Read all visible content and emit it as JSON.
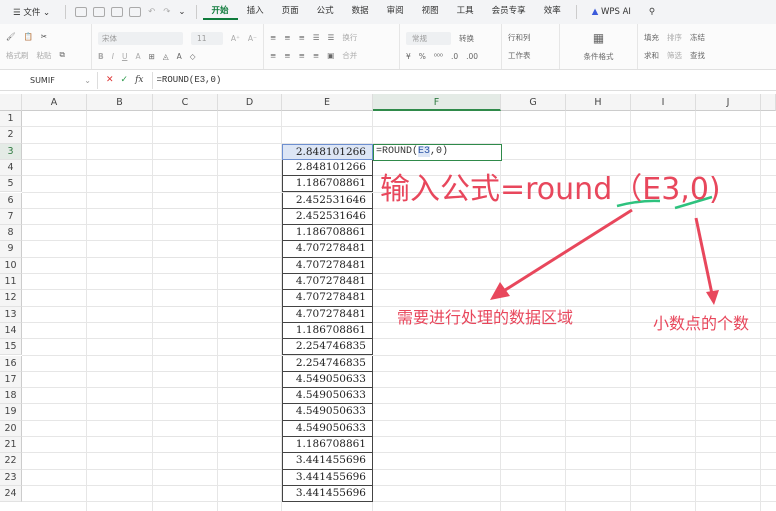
{
  "menubar": {
    "file": "文件",
    "tabs": [
      "开始",
      "插入",
      "页面",
      "公式",
      "数据",
      "审阅",
      "视图",
      "工具",
      "会员专享",
      "效率"
    ],
    "active_tab": "开始",
    "wps_ai": "WPS AI"
  },
  "ribbon": {
    "format_painter": "格式刷",
    "paste": "粘贴",
    "font_name": "宋体",
    "font_size": "11",
    "wrap": "换行",
    "merge": "合并",
    "number_format": "常规",
    "convert": "转换",
    "rows_cols": "行和列",
    "worksheet": "工作表",
    "cond_format": "条件格式",
    "fill": "填充",
    "sort": "排序",
    "freeze": "冻结",
    "sum": "求和",
    "filter": "筛选",
    "find": "查找"
  },
  "formula_bar": {
    "name_box": "SUMIF",
    "formula": "=ROUND(E3,0)"
  },
  "sheet": {
    "columns": [
      "A",
      "B",
      "C",
      "D",
      "E",
      "F",
      "G",
      "H",
      "I",
      "J"
    ],
    "rows": [
      "1",
      "2",
      "3",
      "4",
      "5",
      "6",
      "7",
      "8",
      "9",
      "10",
      "11",
      "12",
      "13",
      "14",
      "15",
      "16",
      "17",
      "18",
      "19",
      "20",
      "21",
      "22",
      "23",
      "24"
    ],
    "e_values": [
      "2.848101266",
      "2.848101266",
      "1.186708861",
      "2.452531646",
      "2.452531646",
      "1.186708861",
      "4.707278481",
      "4.707278481",
      "4.707278481",
      "4.707278481",
      "4.707278481",
      "1.186708861",
      "2.254746835",
      "2.254746835",
      "4.549050633",
      "4.549050633",
      "4.549050633",
      "4.549050633",
      "1.186708861",
      "3.441455696",
      "3.441455696",
      "3.441455696"
    ],
    "f3_prefix": "=ROUND(",
    "f3_ref": "E3",
    "f3_suffix": ",0)"
  },
  "annotations": {
    "title": "输入公式=round（E3,0)",
    "data_range": "需要进行处理的数据区域",
    "decimals": "小数点的个数",
    "color": "#e8475c",
    "underline_color": "#2ec27e"
  }
}
